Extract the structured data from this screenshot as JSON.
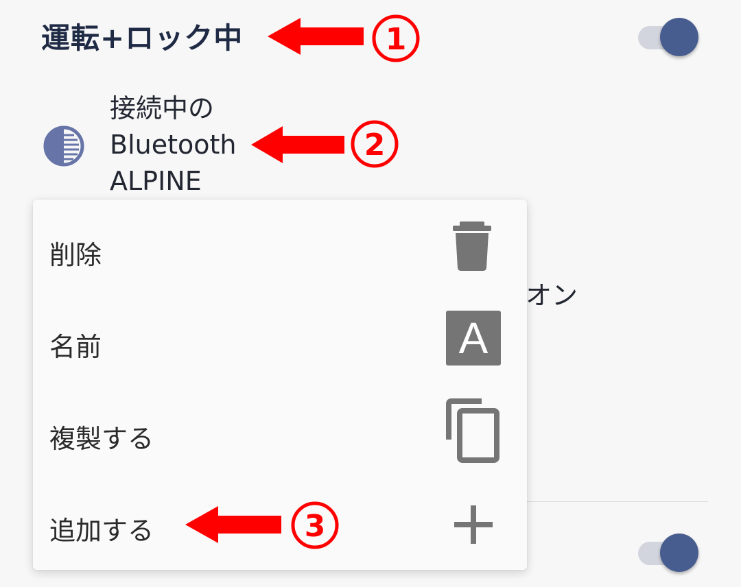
{
  "header_row": {
    "title": "運転+ロック中",
    "toggle_on": true
  },
  "bluetooth_row": {
    "icon": "half-circle-lines-icon",
    "lines": [
      "接続中の",
      "Bluetooth",
      "ALPINE"
    ]
  },
  "background_row": {
    "partial_label": "オン"
  },
  "bottom_row": {
    "toggle_on": true
  },
  "context_menu": {
    "items": [
      {
        "label": "削除",
        "icon": "trash-icon"
      },
      {
        "label": "名前",
        "icon": "letter-a-icon",
        "icon_text": "A"
      },
      {
        "label": "複製する",
        "icon": "copy-icon"
      },
      {
        "label": "追加する",
        "icon": "plus-icon"
      }
    ]
  },
  "annotations": [
    {
      "number": "①"
    },
    {
      "number": "②"
    },
    {
      "number": "③"
    }
  ],
  "colors": {
    "accent": "#485d8f",
    "annotation_red": "#ff0000",
    "icon_gray": "#757575"
  }
}
